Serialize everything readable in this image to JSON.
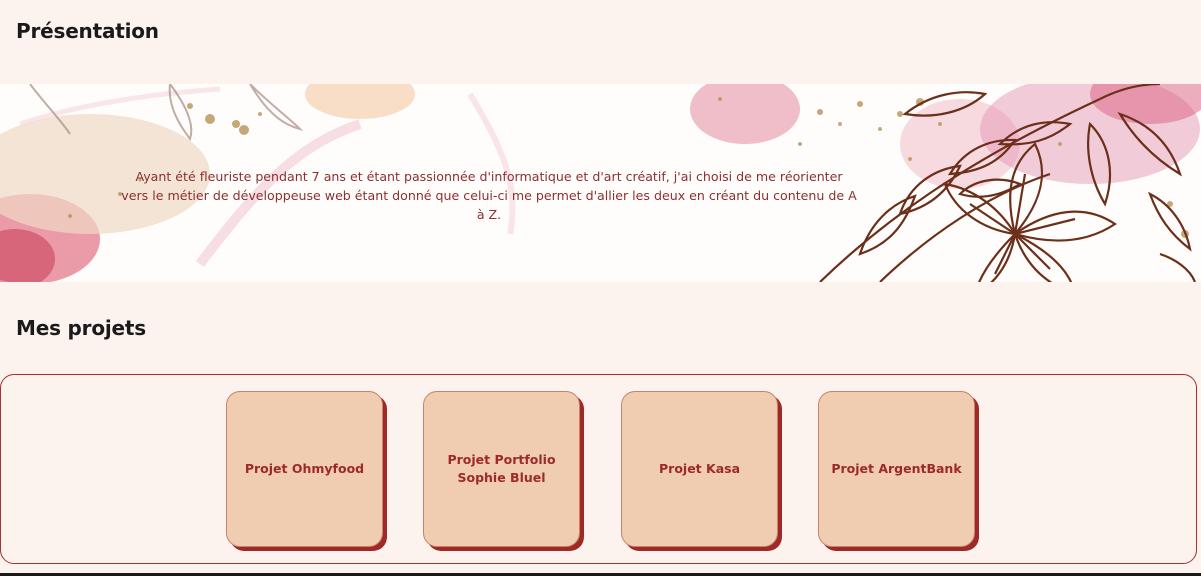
{
  "presentation": {
    "title": "Présentation",
    "text": "Ayant été fleuriste pendant 7 ans et étant passionnée d'informatique et d'art créatif, j'ai choisi de me réorienter vers le métier de développeuse web étant donné que celui-ci me permet d'allier les deux en créant du contenu de A à Z."
  },
  "projects": {
    "title": "Mes projets",
    "items": [
      {
        "label": "Projet Ohmyfood"
      },
      {
        "label": "Projet Portfolio Sophie Bluel"
      },
      {
        "label": "Projet Kasa"
      },
      {
        "label": "Projet ArgentBank"
      }
    ]
  },
  "colors": {
    "page_background": "#fdf3ee",
    "accent": "#9e2a28",
    "card_background": "#f0ccb0",
    "heading": "#1a1a1a"
  },
  "icons": {
    "banner": "floral-watercolor-illustration"
  }
}
